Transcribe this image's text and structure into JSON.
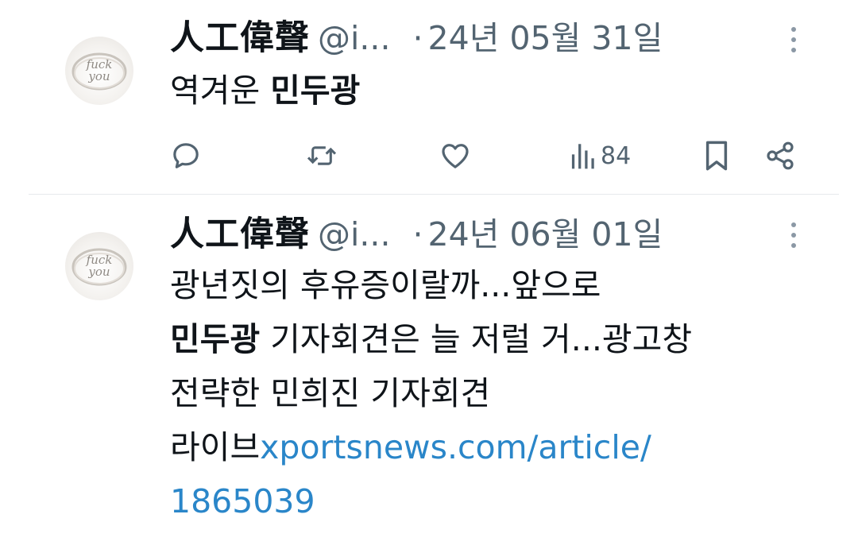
{
  "tweets": [
    {
      "author_name": "人工偉聲",
      "handle": "@i...",
      "separator": "·",
      "date": "24년 05월 31일",
      "text_plain": "역겨운 ",
      "text_bold": "민두광",
      "views": "84",
      "actions": {
        "reply_icon": "reply-icon",
        "retweet_icon": "retweet-icon",
        "like_icon": "heart-icon",
        "views_icon": "views-bar-chart-icon",
        "bookmark_icon": "bookmark-icon",
        "share_icon": "share-icon"
      }
    },
    {
      "author_name": "人工偉聲",
      "handle": "@i...",
      "separator": "·",
      "date": "24년 06월 01일",
      "line1": "광년짓의 후유증이랄까...앞으로",
      "line2_bold": "민두광",
      "line2_rest": " 기자회견은 늘 저럴 거...광고창",
      "line3": "전략한 민희진 기자회견",
      "line4_plain": "라이브",
      "line4_link": "xportsnews.com/article/",
      "line5_link": "1865039"
    }
  ],
  "avatar_text": "fuck you",
  "colors": {
    "secondary_text": "#536471",
    "link": "#2a86c9",
    "divider": "#e6e9ec"
  }
}
